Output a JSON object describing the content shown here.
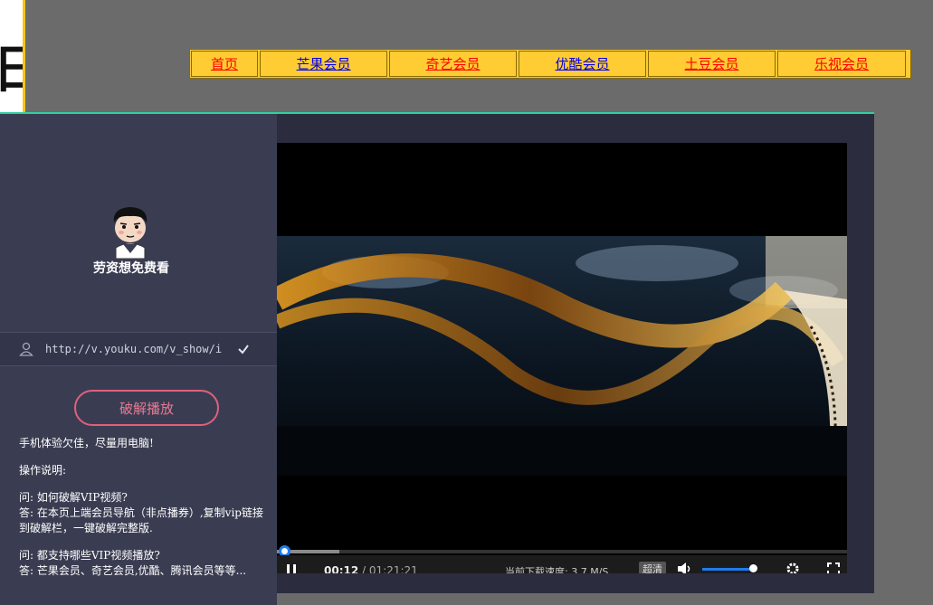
{
  "nav": {
    "items": [
      {
        "label": "首页",
        "color": "red"
      },
      {
        "label": "芒果会员",
        "color": "blue"
      },
      {
        "label": "奇艺会员",
        "color": "red"
      },
      {
        "label": "优酷会员",
        "color": "blue"
      },
      {
        "label": "土豆会员",
        "color": "red"
      },
      {
        "label": "乐视会员",
        "color": "red"
      }
    ]
  },
  "logo": {
    "glyph": "旧"
  },
  "sidebar": {
    "brand": "劳资想免费看",
    "url_value": "http://v.youku.com/v_show/i",
    "crack_button": "破解播放",
    "tip": "手机体验欠佳，尽量用电脑!",
    "howto_title": "操作说明:",
    "q1": "问: 如何破解VIP视频?",
    "a1": "答: 在本页上端会员导航（非点播券）,复制vip链接到破解栏，一键破解完整版.",
    "q2": "问: 都支持哪些VIP视频播放?",
    "a2": "答: 芒果会员、奇艺会员,优酷、腾讯会员等等..."
  },
  "player": {
    "current_time": "00:12",
    "separator": " / ",
    "duration": "01:21:21",
    "speed_text": "当前下载速度: 3.7 M/S",
    "quality": "超清",
    "progress": 0.11,
    "volume": 0.9
  },
  "colors": {
    "nav_bg": "#ffcc33",
    "panel_bg": "#2b2d3e",
    "sidebar_bg": "#3a3d52",
    "accent_pink": "#e0607e",
    "accent_blue": "#1e7cf0",
    "panel_top_border": "#2fd0a0"
  }
}
